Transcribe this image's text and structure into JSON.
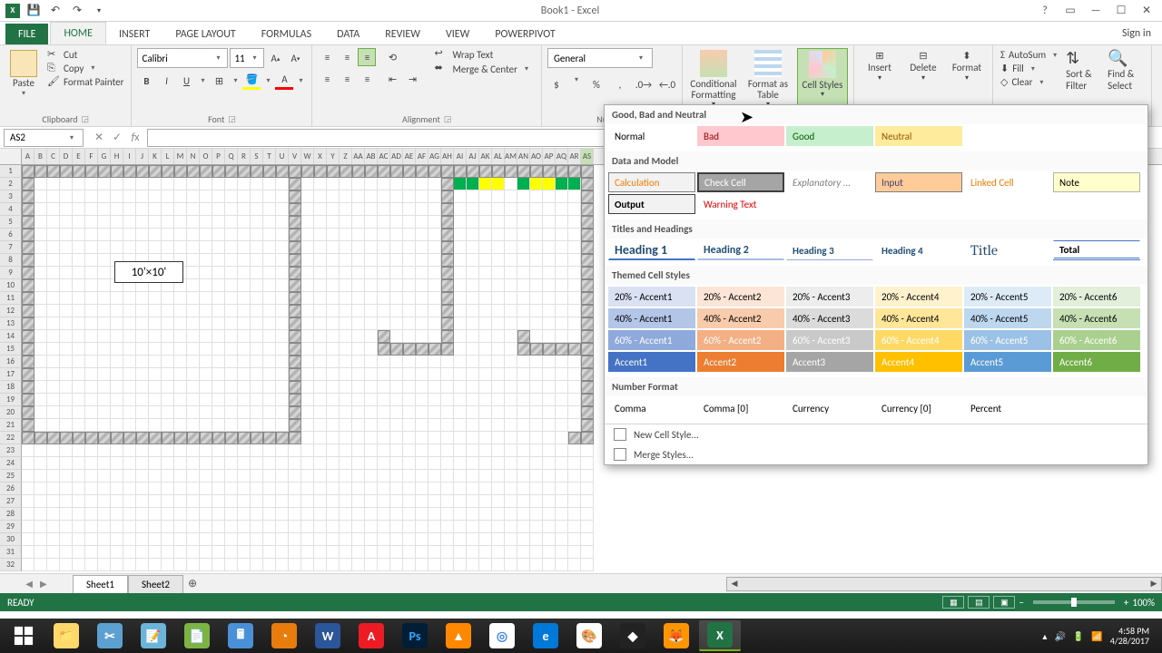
{
  "window": {
    "title": "Book1 - Excel"
  },
  "qat": {
    "undo": "↶",
    "redo": "↷"
  },
  "signin": "Sign in",
  "tabs": {
    "file": "FILE",
    "home": "HOME",
    "insert": "INSERT",
    "page_layout": "PAGE LAYOUT",
    "formulas": "FORMULAS",
    "data": "DATA",
    "review": "REVIEW",
    "view": "VIEW",
    "powerpivot": "POWERPIVOT"
  },
  "clipboard": {
    "paste": "Paste",
    "cut": "Cut",
    "copy": "Copy",
    "painter": "Format Painter",
    "label": "Clipboard"
  },
  "font": {
    "name": "Calibri",
    "size": "11",
    "label": "Font"
  },
  "alignment": {
    "wrap": "Wrap Text",
    "merge": "Merge & Center",
    "label": "Alignment"
  },
  "number": {
    "format": "General",
    "label": "Number"
  },
  "styles": {
    "cond": "Conditional Formatting",
    "table": "Format as Table",
    "cell": "Cell Styles"
  },
  "cells": {
    "insert": "Insert",
    "delete": "Delete",
    "format": "Format"
  },
  "editing": {
    "autosum": "AutoSum",
    "fill": "Fill",
    "clear": "Clear",
    "sort": "Sort & Filter",
    "find": "Find & Select"
  },
  "namebox": "AS2",
  "overlay_text": "10'×10'",
  "gallery": {
    "h_good": "Good, Bad and Neutral",
    "normal": "Normal",
    "bad": "Bad",
    "good": "Good",
    "neutral": "Neutral",
    "h_data": "Data and Model",
    "calc": "Calculation",
    "check": "Check Cell",
    "expl": "Explanatory ...",
    "input": "Input",
    "linked": "Linked Cell",
    "note": "Note",
    "output": "Output",
    "warn": "Warning Text",
    "h_titles": "Titles and Headings",
    "h1": "Heading 1",
    "h2": "Heading 2",
    "h3": "Heading 3",
    "h4": "Heading 4",
    "title": "Title",
    "total": "Total",
    "h_themed": "Themed Cell Styles",
    "a20_1": "20% - Accent1",
    "a20_2": "20% - Accent2",
    "a20_3": "20% - Accent3",
    "a20_4": "20% - Accent4",
    "a20_5": "20% - Accent5",
    "a20_6": "20% - Accent6",
    "a40_1": "40% - Accent1",
    "a40_2": "40% - Accent2",
    "a40_3": "40% - Accent3",
    "a40_4": "40% - Accent4",
    "a40_5": "40% - Accent5",
    "a40_6": "40% - Accent6",
    "a60_1": "60% - Accent1",
    "a60_2": "60% - Accent2",
    "a60_3": "60% - Accent3",
    "a60_4": "60% - Accent4",
    "a60_5": "60% - Accent5",
    "a60_6": "60% - Accent6",
    "a_1": "Accent1",
    "a_2": "Accent2",
    "a_3": "Accent3",
    "a_4": "Accent4",
    "a_5": "Accent5",
    "a_6": "Accent6",
    "h_numfmt": "Number Format",
    "comma": "Comma",
    "comma0": "Comma [0]",
    "currency": "Currency",
    "currency0": "Currency [0]",
    "percent": "Percent",
    "newstyle": "New Cell Style...",
    "merge": "Merge Styles..."
  },
  "sheets": {
    "s1": "Sheet1",
    "s2": "Sheet2"
  },
  "status": {
    "ready": "READY",
    "zoom": "100%"
  },
  "tray": {
    "time": "4:58 PM",
    "date": "4/28/2017"
  },
  "col_labels": [
    "A",
    "B",
    "C",
    "D",
    "E",
    "F",
    "G",
    "H",
    "I",
    "J",
    "K",
    "L",
    "M",
    "N",
    "O",
    "P",
    "Q",
    "R",
    "S",
    "T",
    "U",
    "V",
    "W",
    "X",
    "Y",
    "Z",
    "AA",
    "AB",
    "AC",
    "AD",
    "AE",
    "AF",
    "AG",
    "AH",
    "AI",
    "AJ",
    "AK",
    "AL",
    "AM",
    "AN",
    "AO",
    "AP",
    "AQ",
    "AR",
    "AS"
  ]
}
